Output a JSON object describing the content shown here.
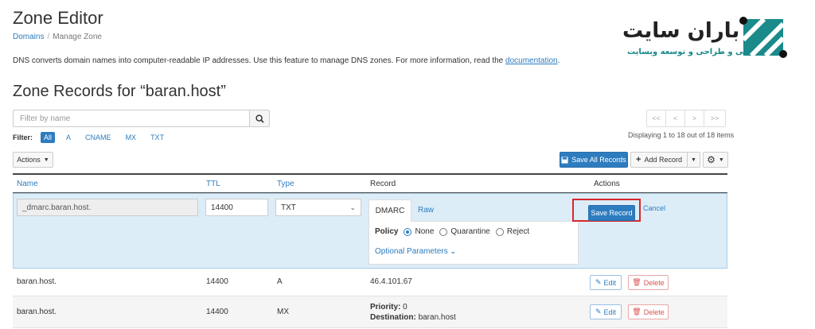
{
  "page": {
    "title": "Zone Editor",
    "breadcrumb": [
      "Domains",
      "Manage Zone"
    ],
    "intro_text": "DNS converts domain names into computer-readable IP addresses. Use this feature to manage DNS zones. For more information, read the",
    "intro_link": "documentation",
    "intro_end": "."
  },
  "logo": {
    "title": "باران سایت",
    "subtitle": "میزبانی و طراحی و توسعه وبسایت",
    "accent_color": "#1a8a8a"
  },
  "zone": {
    "heading": "Zone Records for “baran.host”",
    "filter_placeholder": "Filter by name",
    "filter_label": "Filter:",
    "filter_types": [
      "All",
      "A",
      "CNAME",
      "MX",
      "TXT"
    ],
    "active_filter": "All",
    "pager": [
      "<<",
      "<",
      ">",
      ">>"
    ],
    "pager_info": "Displaying 1 to 18 out of 18 items"
  },
  "toolbar": {
    "actions_label": "Actions",
    "save_all_label": "Save All Records",
    "add_record_label": "Add Record"
  },
  "columns": {
    "name": "Name",
    "ttl": "TTL",
    "type": "Type",
    "record": "Record",
    "actions": "Actions"
  },
  "edit_row": {
    "name": "_dmarc.baran.host.",
    "ttl": "14400",
    "type": "TXT",
    "tabs": [
      "DMARC",
      "Raw"
    ],
    "policy_label": "Policy",
    "policy_options": [
      "None",
      "Quarantine",
      "Reject"
    ],
    "policy_selected": "None",
    "optional_label": "Optional Parameters",
    "save_label": "Save Record",
    "cancel_label": "Cancel",
    "highlight_color": "#d9262c"
  },
  "rows": [
    {
      "name": "baran.host.",
      "ttl": "14400",
      "type": "A",
      "record": "46.4.101.67",
      "edit": "Edit",
      "delete": "Delete"
    },
    {
      "name": "baran.host.",
      "ttl": "14400",
      "type": "MX",
      "priority_label": "Priority:",
      "priority": "0",
      "destination_label": "Destination:",
      "destination": "baran.host",
      "edit": "Edit",
      "delete": "Delete"
    }
  ],
  "colors": {
    "primary": "#2d7cbf",
    "danger": "#d9534f",
    "edit_bg": "#dcedf8"
  }
}
